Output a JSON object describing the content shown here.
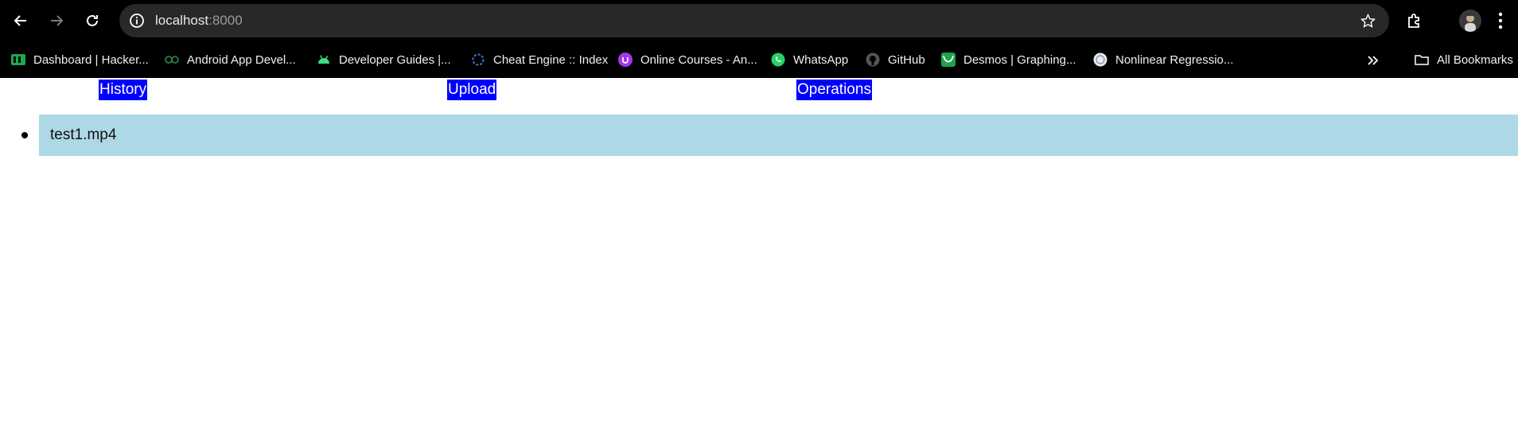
{
  "browser": {
    "url_host": "localhost",
    "url_port": ":8000",
    "bookmarks": [
      {
        "label": "Dashboard | Hacker...",
        "icon": "hackerrank-icon"
      },
      {
        "label": "Android App Devel...",
        "icon": "geeksforgeeks-icon"
      },
      {
        "label": "Developer Guides  |...",
        "icon": "android-icon"
      },
      {
        "label": "Cheat Engine :: Index",
        "icon": "cheat-engine-icon"
      },
      {
        "label": "Online Courses - An...",
        "icon": "udemy-icon"
      },
      {
        "label": "WhatsApp",
        "icon": "whatsapp-icon"
      },
      {
        "label": "GitHub",
        "icon": "github-icon"
      },
      {
        "label": "Desmos | Graphing...",
        "icon": "desmos-icon"
      },
      {
        "label": "Nonlinear Regressio...",
        "icon": "globe-icon"
      }
    ],
    "all_bookmarks_label": "All Bookmarks"
  },
  "page": {
    "nav": [
      {
        "label": "History"
      },
      {
        "label": "Upload"
      },
      {
        "label": "Operations"
      }
    ],
    "files": [
      {
        "name": "test1.mp4"
      }
    ]
  },
  "colors": {
    "nav_link_bg": "#0000ff",
    "file_row_bg": "#add8e6"
  }
}
